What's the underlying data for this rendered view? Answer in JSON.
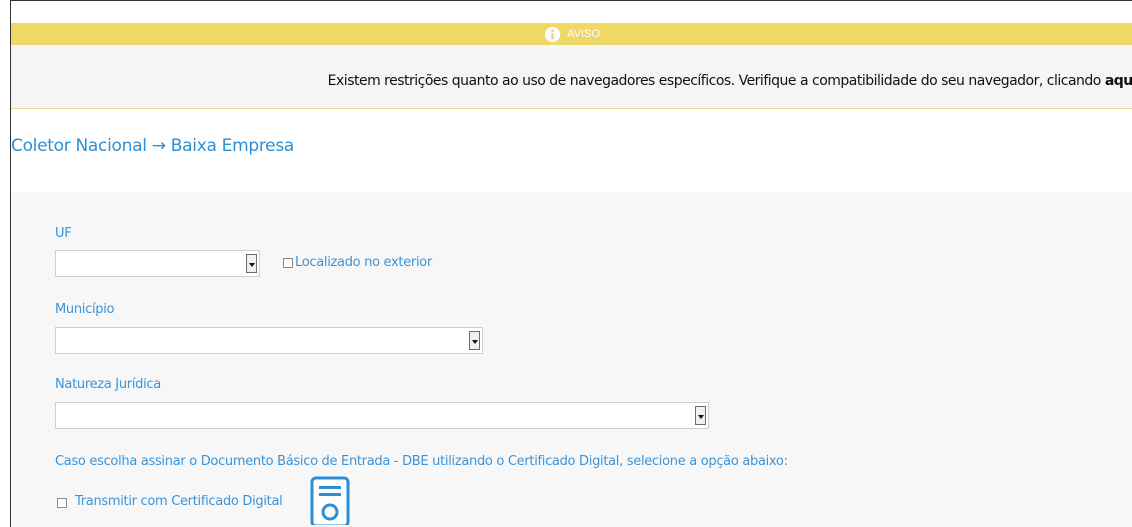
{
  "aviso": {
    "label": "AVISO",
    "message_prefix": "Existem restrições quanto ao uso de navegadores específicos. Verifique a compatibilidade do seu navegador, clicando ",
    "link": "aqui",
    "message_suffix": "."
  },
  "breadcrumb": "Coletor Nacional → Baixa Empresa",
  "form": {
    "uf_label": "UF",
    "uf_value": "",
    "exterior_label": "Localizado no exterior",
    "municipio_label": "Município",
    "municipio_value": "",
    "natureza_label": "Natureza Jurídica",
    "natureza_value": "",
    "dbe_note": "Caso escolha assinar o Documento Básico de Entrada - DBE utilizando o Certificado Digital, selecione a opção abaixo:",
    "cert_label": "Transmitir com Certificado Digital"
  },
  "colors": {
    "aviso_bar": "#f0d866",
    "link_blue": "#2c8fd6",
    "panel": "#f7f7f7"
  },
  "icons": {
    "aviso": "info-icon",
    "certificate": "certificate-icon"
  }
}
